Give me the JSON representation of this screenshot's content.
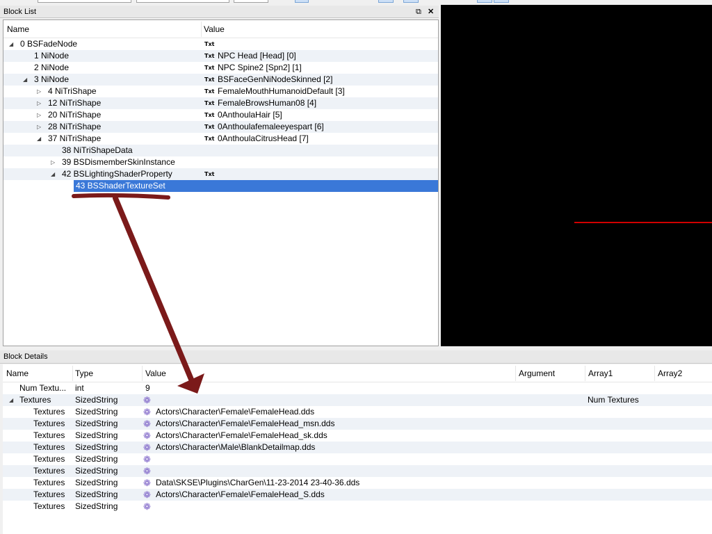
{
  "block_list": {
    "title": "Block List",
    "columns": [
      "Name",
      "Value"
    ],
    "rows": [
      {
        "name": "0 BSFadeNode",
        "value": "",
        "txt": "Txt"
      },
      {
        "name": "1 NiNode",
        "value": "NPC Head [Head] [0]",
        "txt": "Txt"
      },
      {
        "name": "2 NiNode",
        "value": "NPC Spine2 [Spn2] [1]",
        "txt": "Txt"
      },
      {
        "name": "3 NiNode",
        "value": "BSFaceGenNiNodeSkinned [2]",
        "txt": "Txt"
      },
      {
        "name": "4 NiTriShape",
        "value": "FemaleMouthHumanoidDefault [3]",
        "txt": "Txt"
      },
      {
        "name": "12 NiTriShape",
        "value": "FemaleBrowsHuman08 [4]",
        "txt": "Txt"
      },
      {
        "name": "20 NiTriShape",
        "value": "0AnthoulaHair [5]",
        "txt": "Txt"
      },
      {
        "name": "28 NiTriShape",
        "value": "0Anthoulafemaleeyespart [6]",
        "txt": "Txt"
      },
      {
        "name": "37 NiTriShape",
        "value": "0AnthoulaCitrusHead [7]",
        "txt": "Txt"
      },
      {
        "name": "38 NiTriShapeData",
        "value": "",
        "txt": ""
      },
      {
        "name": "39 BSDismemberSkinInstance",
        "value": "",
        "txt": ""
      },
      {
        "name": "42 BSLightingShaderProperty",
        "value": "",
        "txt": "Txt"
      },
      {
        "name": "43 BSShaderTextureSet",
        "value": "",
        "txt": ""
      }
    ]
  },
  "block_details": {
    "title": "Block Details",
    "columns": [
      "Name",
      "Type",
      "Value",
      "Argument",
      "Array1",
      "Array2"
    ],
    "rows": [
      {
        "name": "Num Textu...",
        "type": "int",
        "value": "9",
        "array1": ""
      },
      {
        "name": "Textures",
        "type": "SizedString",
        "value": "",
        "array1": "Num Textures"
      },
      {
        "name": "Textures",
        "type": "SizedString",
        "value": "Actors\\Character\\Female\\FemaleHead.dds",
        "array1": ""
      },
      {
        "name": "Textures",
        "type": "SizedString",
        "value": "Actors\\Character\\Female\\FemaleHead_msn.dds",
        "array1": ""
      },
      {
        "name": "Textures",
        "type": "SizedString",
        "value": "Actors\\Character\\Female\\FemaleHead_sk.dds",
        "array1": ""
      },
      {
        "name": "Textures",
        "type": "SizedString",
        "value": "Actors\\Character\\Male\\BlankDetailmap.dds",
        "array1": ""
      },
      {
        "name": "Textures",
        "type": "SizedString",
        "value": "",
        "array1": ""
      },
      {
        "name": "Textures",
        "type": "SizedString",
        "value": "",
        "array1": ""
      },
      {
        "name": "Textures",
        "type": "SizedString",
        "value": "Data\\SKSE\\Plugins\\CharGen\\11-23-2014 23-40-36.dds",
        "array1": ""
      },
      {
        "name": "Textures",
        "type": "SizedString",
        "value": "Actors\\Character\\Female\\FemaleHead_S.dds",
        "array1": ""
      },
      {
        "name": "Textures",
        "type": "SizedString",
        "value": "",
        "array1": ""
      }
    ]
  },
  "icons": {
    "float": "restore-window-icon",
    "close": "close-icon",
    "expanded": "tree-expanded-icon",
    "collapsed": "tree-collapsed-icon",
    "string_value": "sized-string-value-icon"
  },
  "colors": {
    "selection": "#3a78d8",
    "annotation": "#7b1a1a",
    "render_background": "#000000",
    "render_line": "#d00000"
  }
}
